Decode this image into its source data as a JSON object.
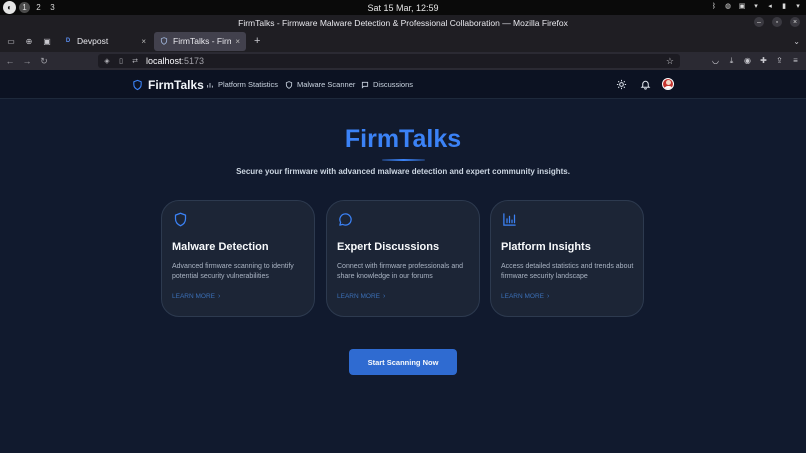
{
  "os": {
    "workspaces": [
      "1",
      "2",
      "3"
    ],
    "clock": "Sat 15 Mar, 12:59"
  },
  "browser": {
    "window_title": "FirmTalks - Firmware Malware Detection & Professional Collaboration — Mozilla Firefox",
    "tabs": [
      {
        "title": "Devpost",
        "favicon": "D",
        "active": false
      },
      {
        "title": "FirmTalks - Firmwa",
        "favicon": "shield",
        "active": true
      }
    ],
    "url_host": "localhost",
    "url_port": ":5173"
  },
  "app": {
    "brand": "FirmTalks",
    "nav": [
      {
        "label": "Platform Statistics",
        "icon": "bar-chart-icon"
      },
      {
        "label": "Malware Scanner",
        "icon": "shield-icon"
      },
      {
        "label": "Discussions",
        "icon": "chat-icon"
      }
    ],
    "hero": {
      "title": "FirmTalks",
      "subtitle": "Secure your firmware with advanced malware detection and expert community insights."
    },
    "cards": [
      {
        "title": "Malware Detection",
        "description": "Advanced firmware scanning to identify potential security vulnerabilities",
        "link": "LEARN MORE",
        "icon": "shield-icon"
      },
      {
        "title": "Expert Discussions",
        "description": "Connect with firmware professionals and share knowledge in our forums",
        "link": "LEARN MORE",
        "icon": "chat-bubble-icon"
      },
      {
        "title": "Platform Insights",
        "description": "Access detailed statistics and trends about firmware security landscape",
        "link": "LEARN MORE",
        "icon": "bar-chart-icon"
      }
    ],
    "cta": "Start Scanning Now"
  },
  "colors": {
    "accent": "#3b82f6",
    "page_bg": "#111a2e",
    "card_bg": "#1c2536",
    "cta_bg": "#2f6bd1"
  }
}
